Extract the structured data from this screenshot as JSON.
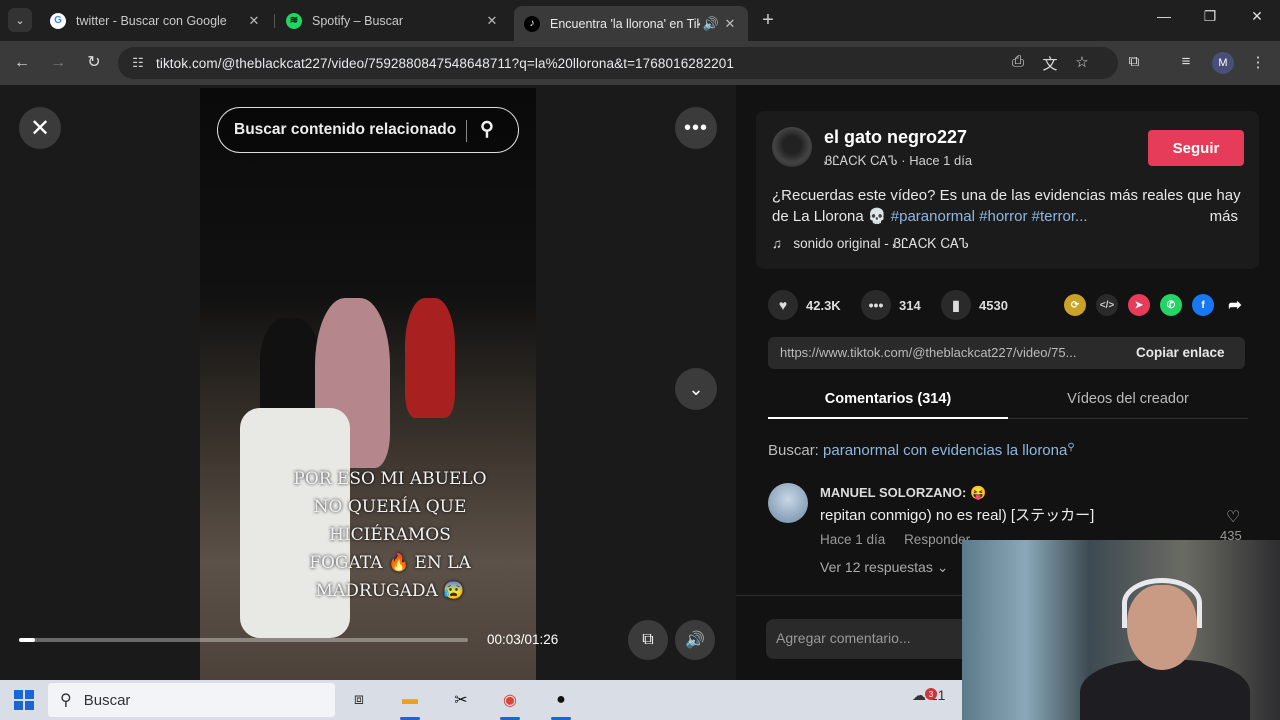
{
  "browser": {
    "tabs": [
      {
        "title": "twitter - Buscar con Google",
        "favicon": "google-icon",
        "active": false
      },
      {
        "title": "Spotify – Buscar",
        "favicon": "spotify-icon",
        "active": false
      },
      {
        "title": "Encuentra 'la llorona' en Tik",
        "favicon": "tiktok-icon",
        "active": true
      }
    ],
    "url": "tiktok.com/@theblackcat227/video/7592880847548648711?q=la%20llorona&t=1768016282201",
    "profile_initial": "M"
  },
  "player": {
    "search_placeholder": "Buscar contenido relacionado",
    "caption_lines": [
      "POR ESO MI ABUELO",
      "NO QUERÍA QUE HICIÉRAMOS",
      "FOGATA 🔥 EN LA MADRUGADA 😰"
    ],
    "time": "00:03/01:26",
    "progress": 0.035
  },
  "creator": {
    "display_name": "el gato negro227",
    "username": "ᏰᏝᎪᏟᏦ ᏟᎪᏖ",
    "posted": "Hace 1 día",
    "follow_label": "Seguir"
  },
  "description": {
    "text": "¿Recuerdas este vídeo? Es una de las evidencias más reales que hay de La Llorona 💀",
    "tags": "#paranormal #horror #terror...",
    "more_label": "más",
    "sound": "sonido original - ᏰᏝᎪᏟᏦ ᏟᎪᏖ"
  },
  "stats": {
    "likes": "42.3K",
    "comments": "314",
    "saves": "4530"
  },
  "share": {
    "link": "https://www.tiktok.com/@theblackcat227/video/75...",
    "copy_label": "Copiar enlace"
  },
  "tabs": {
    "comments": "Comentarios (314)",
    "creator_videos": "Vídeos del creador"
  },
  "search_suggestion": {
    "prefix": "Buscar:",
    "query": "paranormal con evidencias la llorona"
  },
  "comments": [
    {
      "author": "MANUEL SOLORZANO: 😝",
      "text": "repitan conmigo) no es real) [ステッカー]",
      "time": "Hace 1 día",
      "reply_label": "Responder",
      "likes": "435",
      "replies_label": "Ver 12 respuestas"
    }
  ],
  "add_comment_placeholder": "Agregar comentario...",
  "taskbar": {
    "search_label": "Buscar",
    "weather_temp": "21",
    "notification_count": "3"
  },
  "colors": {
    "follow": "#e63c5a",
    "tag": "#8fb7e0",
    "accent": "#1a66d6"
  }
}
